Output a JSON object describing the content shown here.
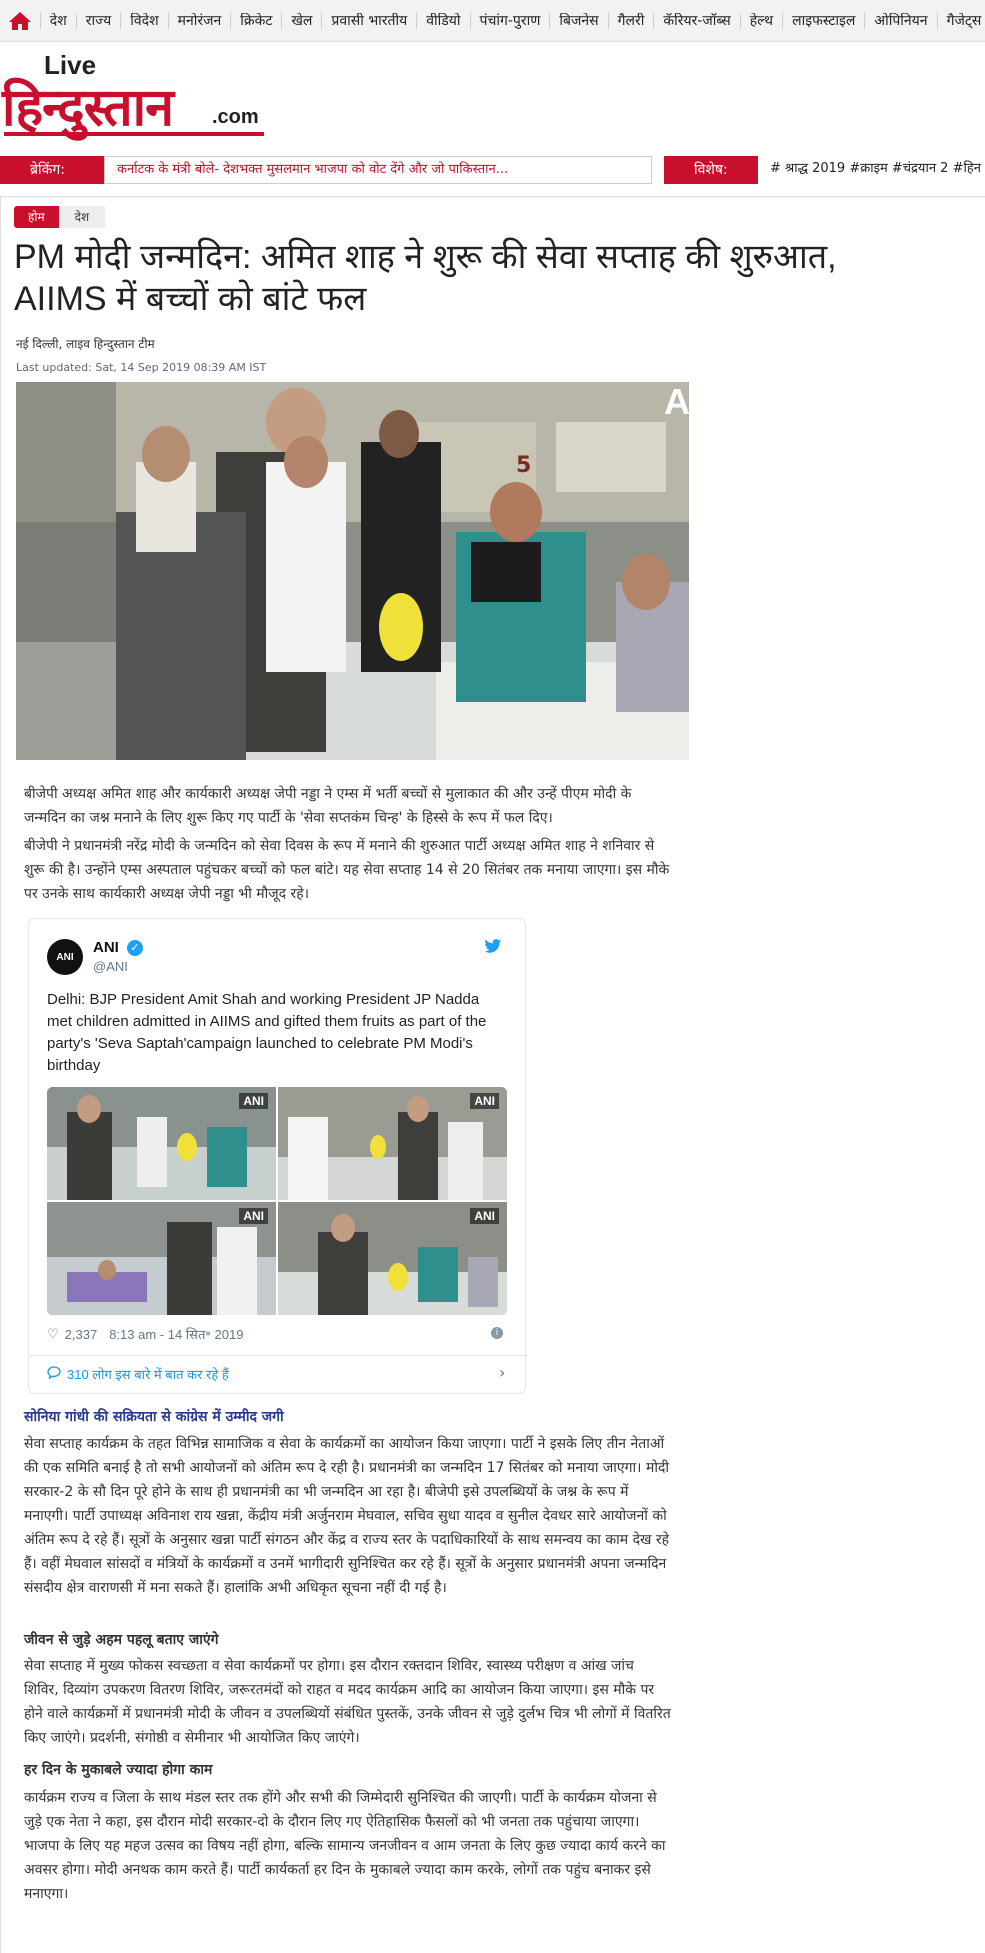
{
  "nav": {
    "items": [
      "देश",
      "राज्य",
      "विदेश",
      "मनोरंजन",
      "क्रिकेट",
      "खेल",
      "प्रवासी भारतीय",
      "वीडियो",
      "पंचांग-पुराण",
      "बिजनेस",
      "गैलरी",
      "कॅरियर-जॉब्स",
      "हेल्थ",
      "लाइफस्टाइल",
      "ओपिनियन",
      "गैजेट्स"
    ]
  },
  "logo": {
    "live": "Live",
    "brand": "हिन्दुस्तान",
    "domain": ".com"
  },
  "ticker": {
    "breaking_label": "ब्रेकिंग:",
    "breaking_text": "कर्नाटक के मंत्री बोले- देशभक्त मुसलमान भाजपा को वोट देंगे और जो पाकिस्तान...",
    "special_label": "विशेष:",
    "special_text": "# श्राद्ध 2019 #क्राइम #चंद्रयान 2 #हिन"
  },
  "breadcrumb": {
    "home": "होम",
    "section": "देश"
  },
  "article": {
    "headline": "PM मोदी जन्मदिन: अमित शाह ने शुरू की सेवा सप्ताह की शुरुआत, AIIMS में बच्चों को बांटे फल",
    "byline": "नई दिल्ली, लाइव हिन्दुस्तान टीम",
    "updated_label": "Last updated:",
    "updated_value": "Sat, 14 Sep 2019 08:39 AM IST",
    "hero_watermark": "A",
    "para1": "बीजेपी अध्यक्ष अमित शाह और कार्यकारी अध्यक्ष जेपी नड्डा ने एम्स में भर्ती बच्चों से मुलाकात की और उन्हें पीएम मोदी के जन्मदिन का जश्न मनाने के लिए शुरू किए गए पार्टी के 'सेवा सप्तकंम चिन्ह' के हिस्से के रूप में फल दिए।",
    "para2": "बीजेपी ने प्रधानमंत्री नरेंद्र मोदी के जन्मदिन को सेवा दिवस के रूप में मनाने की शुरुआत पार्टी अध्यक्ष अमित शाह ने शनिवार से शुरू की है। उन्होंने एम्स अस्पताल पहुंचकर बच्चों को फल बांटे। यह सेवा सप्ताह 14 से 20 सितंबर तक मनाया जाएगा। इस मौके पर उनके साथ कार्यकारी अध्यक्ष जेपी नड्डा भी मौजूद रहे।",
    "related_link": "सोनिया गांधी की सक्रियता से कांग्रेस में उम्मीद जगी",
    "para3": "सेवा सप्ताह कार्यक्रम के तहत विभिन्न सामाजिक व सेवा के कार्यक्रमों का आयोजन किया जाएगा। पार्टी ने इसके लिए तीन नेताओं की एक समिति बनाई है तो सभी आयोजनों को अंतिम रूप दे रही है। प्रधानमंत्री का जन्मदिन 17 सितंबर को मनाया जाएगा। मोदी सरकार-2 के सौ दिन पूरे होने के साथ ही प्रधानमंत्री का भी जन्मदिन आ रहा है। बीजेपी इसे उपलब्धियों के जश्न के रूप में मनाएगी। पार्टी उपाध्यक्ष अविनाश राय खन्ना, केंद्रीय मंत्री अर्जुनराम मेघवाल, सचिव सुधा यादव व सुनील देवधर सारे आयोजनों को अंतिम रूप दे रहे हैं। सूत्रों के अनुसार खन्ना पार्टी संगठन और केंद्र व राज्य स्तर के पदाधिकारियों के साथ समन्वय का काम देख रहे हैं। वहीं मेघवाल सांसदों व मंत्रियों के कार्यक्रमों व उनमें भागीदारी सुनिश्चित कर रहे हैं। सूत्रों के अनुसार प्रधानमंत्री अपना जन्मदिन संसदीय क्षेत्र वाराणसी में मना सकते हैं। हालांकि अभी अधिकृत सूचना नहीं दी गई है।",
    "subhead1": "जीवन से जुड़े अहम पहलू बताए जाएंगे",
    "para4": "सेवा सप्ताह में मुख्य फोकस स्वच्छता व सेवा कार्यक्रमों पर होगा। इस दौरान रक्तदान शिविर, स्वास्थ्य परीक्षण व आंख जांच शिविर, दिव्यांग उपकरण वितरण शिविर, जरूरतमंदों को राहत व मदद कार्यक्रम आदि का आयोजन किया जाएगा। इस मौके पर होने वाले कार्यक्रमों में प्रधानमंत्री मोदी के जीवन व उपलब्धियों संबंधित पुस्तकें, उनके जीवन से जुड़े दुर्लभ चित्र भी लोगों में वितरित किए जाएंगे। प्रदर्शनी, संगोष्ठी व सेमीनार भी आयोजित किए जाएंगे।",
    "subhead2": "हर दिन के मुकाबले ज्यादा होगा काम",
    "para5": "कार्यक्रम राज्य व जिला के साथ मंडल स्तर तक होंगे और सभी की जिम्मेदारी सुनिश्चित की जाएगी। पार्टी के कार्यक्रम योजना से जुड़े एक नेता ने कहा, इस दौरान मोदी सरकार-दो के दौरान लिए गए ऐतिहासिक फैसलों को भी जनता तक पहुंचाया जाएगा। भाजपा के लिए यह महज उत्सव का विषय नहीं होगा, बल्कि सामान्य जनजीवन व आम जनता के लिए कुछ ज्यादा कार्य करने का अवसर होगा। मोदी अनथक काम करते हैं। पार्टी कार्यकर्ता हर दिन के मुकाबले ज्यादा काम करके, लोगों तक पहुंच बनाकर इसे मनाएगा।"
  },
  "tweet": {
    "avatar_text": "ANI",
    "name": "ANI",
    "handle": "@ANI",
    "text": "Delhi: BJP President Amit Shah and working President JP Nadda met children admitted in AIIMS and gifted them fruits as part of the party's 'Seva Saptah'campaign launched to celebrate PM Modi's birthday",
    "image_badge": "ANI",
    "likes": "2,337",
    "time": "8:13 am - 14 सित॰ 2019",
    "replies": "310 लोग इस बारे में बात कर रहे हैं"
  },
  "colors": {
    "brand_red": "#c8102e",
    "link_blue": "#2b3a8f",
    "twitter_blue": "#1da1f2"
  }
}
